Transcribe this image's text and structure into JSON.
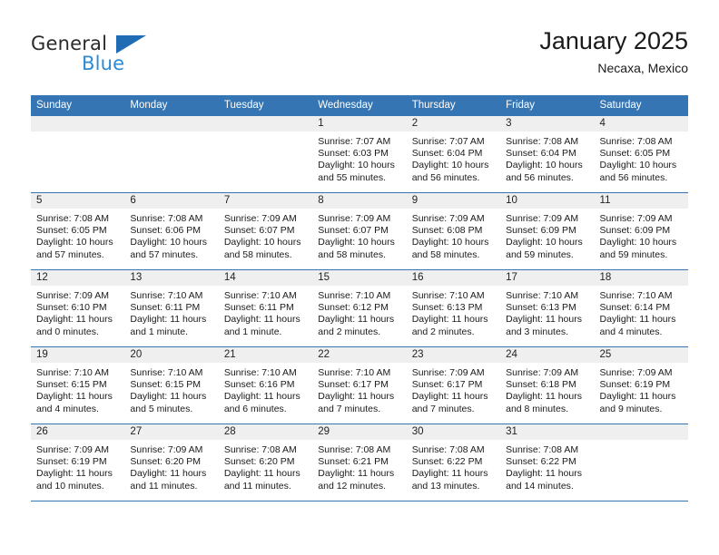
{
  "brand": {
    "word_one": "General",
    "word_two": "Blue",
    "triangle_icon": "triangle-icon",
    "accent_dark_blue": "#1f6cb4",
    "accent_light_blue": "#2d8ad4"
  },
  "header": {
    "title": "January 2025",
    "subtitle": "Necaxa, Mexico"
  },
  "theme": {
    "header_row_bg": "#3575b3",
    "header_row_text": "#ffffff",
    "daynum_band_bg": "#efefef",
    "row_divider": "#3575b3"
  },
  "calendar": {
    "weekday_headers": [
      "Sunday",
      "Monday",
      "Tuesday",
      "Wednesday",
      "Thursday",
      "Friday",
      "Saturday"
    ],
    "weeks": [
      [
        {
          "day": "",
          "sunrise": "",
          "sunset": "",
          "daylight_line1": "",
          "daylight_line2": ""
        },
        {
          "day": "",
          "sunrise": "",
          "sunset": "",
          "daylight_line1": "",
          "daylight_line2": ""
        },
        {
          "day": "",
          "sunrise": "",
          "sunset": "",
          "daylight_line1": "",
          "daylight_line2": ""
        },
        {
          "day": "1",
          "sunrise": "Sunrise: 7:07 AM",
          "sunset": "Sunset: 6:03 PM",
          "daylight_line1": "Daylight: 10 hours",
          "daylight_line2": "and 55 minutes."
        },
        {
          "day": "2",
          "sunrise": "Sunrise: 7:07 AM",
          "sunset": "Sunset: 6:04 PM",
          "daylight_line1": "Daylight: 10 hours",
          "daylight_line2": "and 56 minutes."
        },
        {
          "day": "3",
          "sunrise": "Sunrise: 7:08 AM",
          "sunset": "Sunset: 6:04 PM",
          "daylight_line1": "Daylight: 10 hours",
          "daylight_line2": "and 56 minutes."
        },
        {
          "day": "4",
          "sunrise": "Sunrise: 7:08 AM",
          "sunset": "Sunset: 6:05 PM",
          "daylight_line1": "Daylight: 10 hours",
          "daylight_line2": "and 56 minutes."
        }
      ],
      [
        {
          "day": "5",
          "sunrise": "Sunrise: 7:08 AM",
          "sunset": "Sunset: 6:05 PM",
          "daylight_line1": "Daylight: 10 hours",
          "daylight_line2": "and 57 minutes."
        },
        {
          "day": "6",
          "sunrise": "Sunrise: 7:08 AM",
          "sunset": "Sunset: 6:06 PM",
          "daylight_line1": "Daylight: 10 hours",
          "daylight_line2": "and 57 minutes."
        },
        {
          "day": "7",
          "sunrise": "Sunrise: 7:09 AM",
          "sunset": "Sunset: 6:07 PM",
          "daylight_line1": "Daylight: 10 hours",
          "daylight_line2": "and 58 minutes."
        },
        {
          "day": "8",
          "sunrise": "Sunrise: 7:09 AM",
          "sunset": "Sunset: 6:07 PM",
          "daylight_line1": "Daylight: 10 hours",
          "daylight_line2": "and 58 minutes."
        },
        {
          "day": "9",
          "sunrise": "Sunrise: 7:09 AM",
          "sunset": "Sunset: 6:08 PM",
          "daylight_line1": "Daylight: 10 hours",
          "daylight_line2": "and 58 minutes."
        },
        {
          "day": "10",
          "sunrise": "Sunrise: 7:09 AM",
          "sunset": "Sunset: 6:09 PM",
          "daylight_line1": "Daylight: 10 hours",
          "daylight_line2": "and 59 minutes."
        },
        {
          "day": "11",
          "sunrise": "Sunrise: 7:09 AM",
          "sunset": "Sunset: 6:09 PM",
          "daylight_line1": "Daylight: 10 hours",
          "daylight_line2": "and 59 minutes."
        }
      ],
      [
        {
          "day": "12",
          "sunrise": "Sunrise: 7:09 AM",
          "sunset": "Sunset: 6:10 PM",
          "daylight_line1": "Daylight: 11 hours",
          "daylight_line2": "and 0 minutes."
        },
        {
          "day": "13",
          "sunrise": "Sunrise: 7:10 AM",
          "sunset": "Sunset: 6:11 PM",
          "daylight_line1": "Daylight: 11 hours",
          "daylight_line2": "and 1 minute."
        },
        {
          "day": "14",
          "sunrise": "Sunrise: 7:10 AM",
          "sunset": "Sunset: 6:11 PM",
          "daylight_line1": "Daylight: 11 hours",
          "daylight_line2": "and 1 minute."
        },
        {
          "day": "15",
          "sunrise": "Sunrise: 7:10 AM",
          "sunset": "Sunset: 6:12 PM",
          "daylight_line1": "Daylight: 11 hours",
          "daylight_line2": "and 2 minutes."
        },
        {
          "day": "16",
          "sunrise": "Sunrise: 7:10 AM",
          "sunset": "Sunset: 6:13 PM",
          "daylight_line1": "Daylight: 11 hours",
          "daylight_line2": "and 2 minutes."
        },
        {
          "day": "17",
          "sunrise": "Sunrise: 7:10 AM",
          "sunset": "Sunset: 6:13 PM",
          "daylight_line1": "Daylight: 11 hours",
          "daylight_line2": "and 3 minutes."
        },
        {
          "day": "18",
          "sunrise": "Sunrise: 7:10 AM",
          "sunset": "Sunset: 6:14 PM",
          "daylight_line1": "Daylight: 11 hours",
          "daylight_line2": "and 4 minutes."
        }
      ],
      [
        {
          "day": "19",
          "sunrise": "Sunrise: 7:10 AM",
          "sunset": "Sunset: 6:15 PM",
          "daylight_line1": "Daylight: 11 hours",
          "daylight_line2": "and 4 minutes."
        },
        {
          "day": "20",
          "sunrise": "Sunrise: 7:10 AM",
          "sunset": "Sunset: 6:15 PM",
          "daylight_line1": "Daylight: 11 hours",
          "daylight_line2": "and 5 minutes."
        },
        {
          "day": "21",
          "sunrise": "Sunrise: 7:10 AM",
          "sunset": "Sunset: 6:16 PM",
          "daylight_line1": "Daylight: 11 hours",
          "daylight_line2": "and 6 minutes."
        },
        {
          "day": "22",
          "sunrise": "Sunrise: 7:10 AM",
          "sunset": "Sunset: 6:17 PM",
          "daylight_line1": "Daylight: 11 hours",
          "daylight_line2": "and 7 minutes."
        },
        {
          "day": "23",
          "sunrise": "Sunrise: 7:09 AM",
          "sunset": "Sunset: 6:17 PM",
          "daylight_line1": "Daylight: 11 hours",
          "daylight_line2": "and 7 minutes."
        },
        {
          "day": "24",
          "sunrise": "Sunrise: 7:09 AM",
          "sunset": "Sunset: 6:18 PM",
          "daylight_line1": "Daylight: 11 hours",
          "daylight_line2": "and 8 minutes."
        },
        {
          "day": "25",
          "sunrise": "Sunrise: 7:09 AM",
          "sunset": "Sunset: 6:19 PM",
          "daylight_line1": "Daylight: 11 hours",
          "daylight_line2": "and 9 minutes."
        }
      ],
      [
        {
          "day": "26",
          "sunrise": "Sunrise: 7:09 AM",
          "sunset": "Sunset: 6:19 PM",
          "daylight_line1": "Daylight: 11 hours",
          "daylight_line2": "and 10 minutes."
        },
        {
          "day": "27",
          "sunrise": "Sunrise: 7:09 AM",
          "sunset": "Sunset: 6:20 PM",
          "daylight_line1": "Daylight: 11 hours",
          "daylight_line2": "and 11 minutes."
        },
        {
          "day": "28",
          "sunrise": "Sunrise: 7:08 AM",
          "sunset": "Sunset: 6:20 PM",
          "daylight_line1": "Daylight: 11 hours",
          "daylight_line2": "and 11 minutes."
        },
        {
          "day": "29",
          "sunrise": "Sunrise: 7:08 AM",
          "sunset": "Sunset: 6:21 PM",
          "daylight_line1": "Daylight: 11 hours",
          "daylight_line2": "and 12 minutes."
        },
        {
          "day": "30",
          "sunrise": "Sunrise: 7:08 AM",
          "sunset": "Sunset: 6:22 PM",
          "daylight_line1": "Daylight: 11 hours",
          "daylight_line2": "and 13 minutes."
        },
        {
          "day": "31",
          "sunrise": "Sunrise: 7:08 AM",
          "sunset": "Sunset: 6:22 PM",
          "daylight_line1": "Daylight: 11 hours",
          "daylight_line2": "and 14 minutes."
        },
        {
          "day": "",
          "sunrise": "",
          "sunset": "",
          "daylight_line1": "",
          "daylight_line2": ""
        }
      ]
    ]
  }
}
